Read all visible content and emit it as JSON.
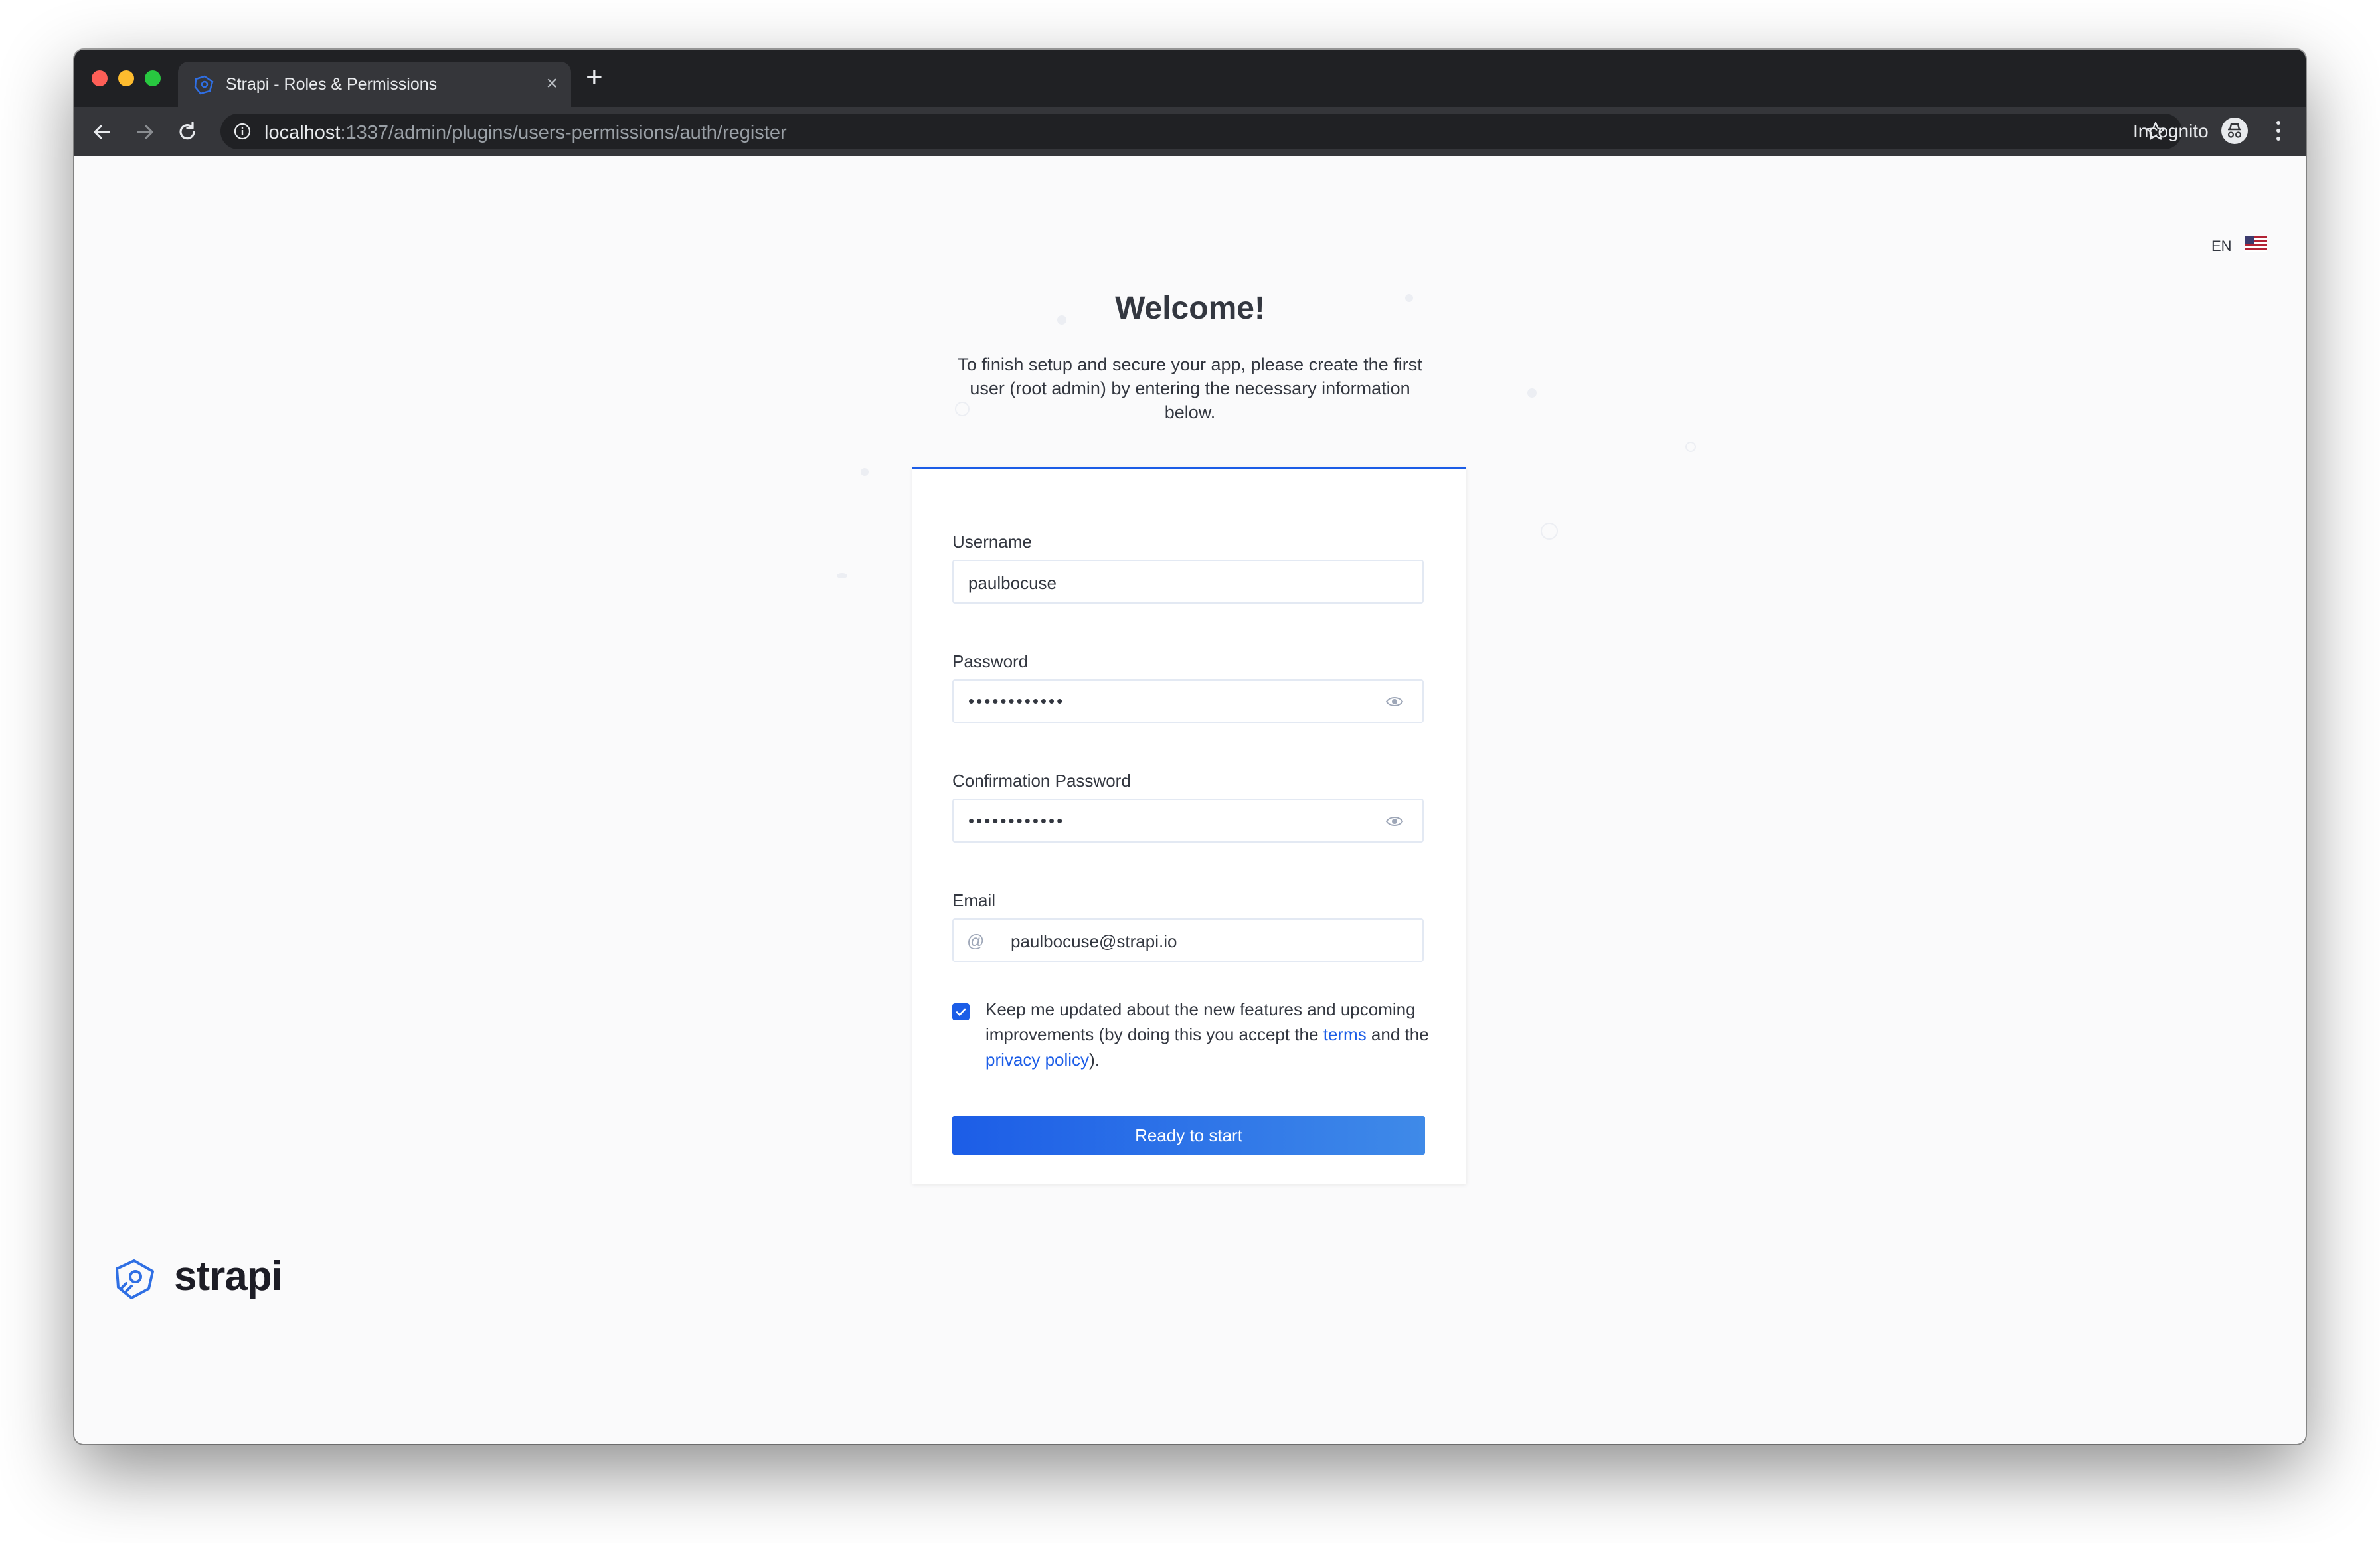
{
  "browser": {
    "tab_title": "Strapi - Roles & Permissions",
    "url_host": "localhost",
    "url_path": ":1337/admin/plugins/users-permissions/auth/register",
    "incognito_label": "Incognito"
  },
  "page": {
    "language": "EN",
    "title": "Welcome!",
    "subtitle": "To finish setup and secure your app, please create the first user (root admin) by entering the necessary information below."
  },
  "form": {
    "username_label": "Username",
    "username_value": "paulbocuse",
    "password_label": "Password",
    "password_masked": "••••••••••••",
    "confirm_label": "Confirmation Password",
    "confirm_masked": "••••••••••••",
    "email_label": "Email",
    "email_prefix": "@",
    "email_value": "paulbocuse@strapi.io",
    "newsletter_checked": true,
    "newsletter_text_before": "Keep me updated about the new features and upcoming improvements (by doing this you accept the ",
    "terms_link": "terms",
    "newsletter_text_middle": " and the ",
    "privacy_link": "privacy policy",
    "newsletter_text_after": ").",
    "submit_label": "Ready to start"
  },
  "footer": {
    "logo_text": "strapi"
  },
  "colors": {
    "accent": "#1c5de7",
    "chrome_dark": "#202124",
    "chrome_tab": "#35363a",
    "page_bg": "#fafafb"
  }
}
